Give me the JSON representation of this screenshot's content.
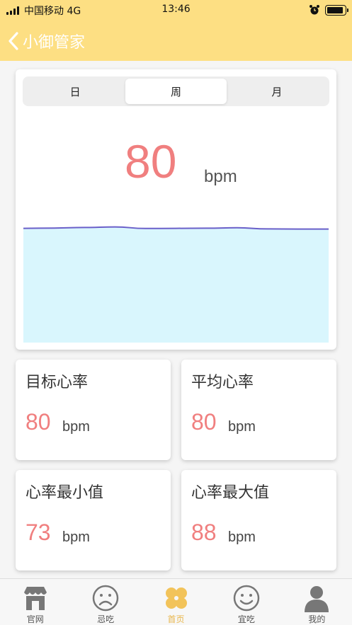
{
  "status": {
    "carrier": "中国移动  4G",
    "time": "13:46",
    "battery_level": 0.9
  },
  "nav": {
    "title": "小御管家",
    "back_icon": "chevron-left-icon"
  },
  "tabs": [
    {
      "label": "日",
      "active": false
    },
    {
      "label": "周",
      "active": true
    },
    {
      "label": "月",
      "active": false
    }
  ],
  "current": {
    "value": "80",
    "unit": "bpm"
  },
  "chart_data": {
    "type": "area",
    "x": [
      0,
      1,
      2,
      3,
      4,
      5,
      6,
      7,
      8,
      9,
      10
    ],
    "series": [
      {
        "values": [
          80,
          80.2,
          80.6,
          81,
          79.9,
          80,
          80.1,
          80.4,
          79.6,
          79.5,
          79.5
        ]
      }
    ],
    "ylim": [
      0,
      100
    ],
    "line_color": "#6a5fc9",
    "fill_color": "#d9f6fd"
  },
  "stats": [
    {
      "title": "目标心率",
      "value": "80",
      "unit": "bpm"
    },
    {
      "title": "平均心率",
      "value": "80",
      "unit": "bpm"
    },
    {
      "title": "心率最小值",
      "value": "73",
      "unit": "bpm"
    },
    {
      "title": "心率最大值",
      "value": "88",
      "unit": "bpm"
    }
  ],
  "tabbar": [
    {
      "label": "官网",
      "icon": "shop-icon",
      "active": false
    },
    {
      "label": "忌吃",
      "icon": "sad-face-icon",
      "active": false
    },
    {
      "label": "首页",
      "icon": "clover-icon",
      "active": true
    },
    {
      "label": "宜吃",
      "icon": "smile-face-icon",
      "active": false
    },
    {
      "label": "我的",
      "icon": "user-icon",
      "active": false
    }
  ],
  "colors": {
    "accent": "#fddf83",
    "value": "#f07f7f",
    "active_tab": "#e8b64c"
  }
}
